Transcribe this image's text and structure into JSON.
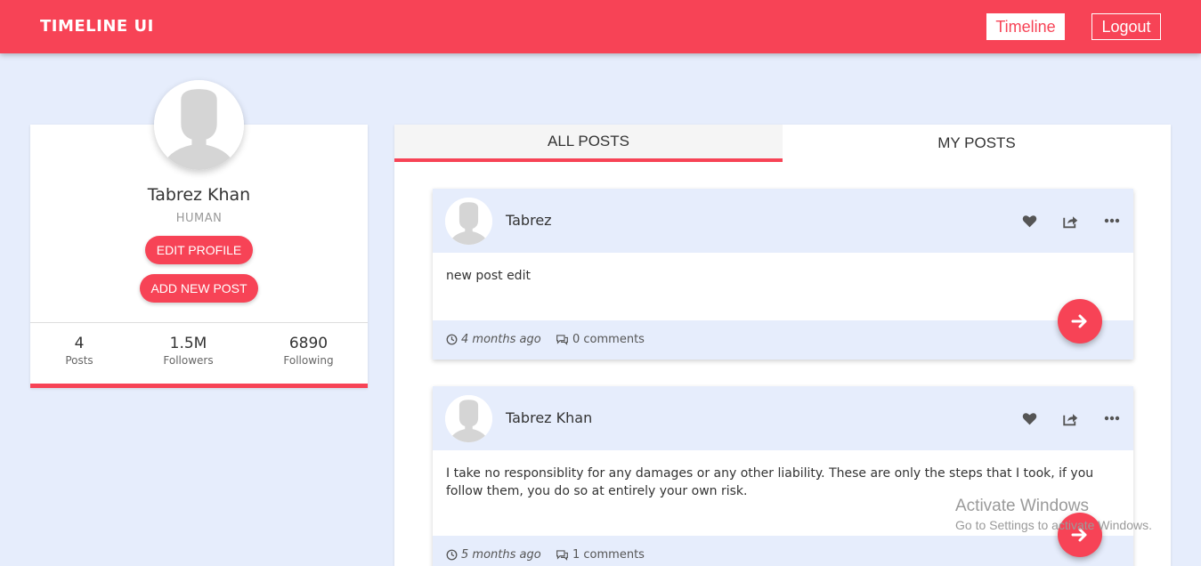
{
  "brand": "TIMELINE UI",
  "nav": {
    "timeline_label": "Timeline",
    "logout_label": "Logout"
  },
  "profile": {
    "name": "Tabrez Khan",
    "role": "HUMAN",
    "edit_label": "EDIT PROFILE",
    "add_post_label": "ADD NEW POST",
    "stats": [
      {
        "value": "4",
        "label": "Posts"
      },
      {
        "value": "1.5M",
        "label": "Followers"
      },
      {
        "value": "6890",
        "label": "Following"
      }
    ]
  },
  "tabs": [
    {
      "label": "ALL POSTS",
      "active": true
    },
    {
      "label": "MY POSTS",
      "active": false
    }
  ],
  "posts": [
    {
      "author": "Tabrez",
      "body": "new post edit",
      "time": "4 months ago",
      "comments": "0 comments"
    },
    {
      "author": "Tabrez Khan",
      "body": "I take no responsiblity for any damages or any other liability. These are only the steps that I took, if you follow them, you do so at entirely your own risk.",
      "time": "5 months ago",
      "comments": "1 comments"
    }
  ],
  "watermark": {
    "title": "Activate Windows",
    "subtitle": "Go to Settings to activate Windows."
  },
  "colors": {
    "accent": "#f74356",
    "background": "#e6edfc"
  }
}
